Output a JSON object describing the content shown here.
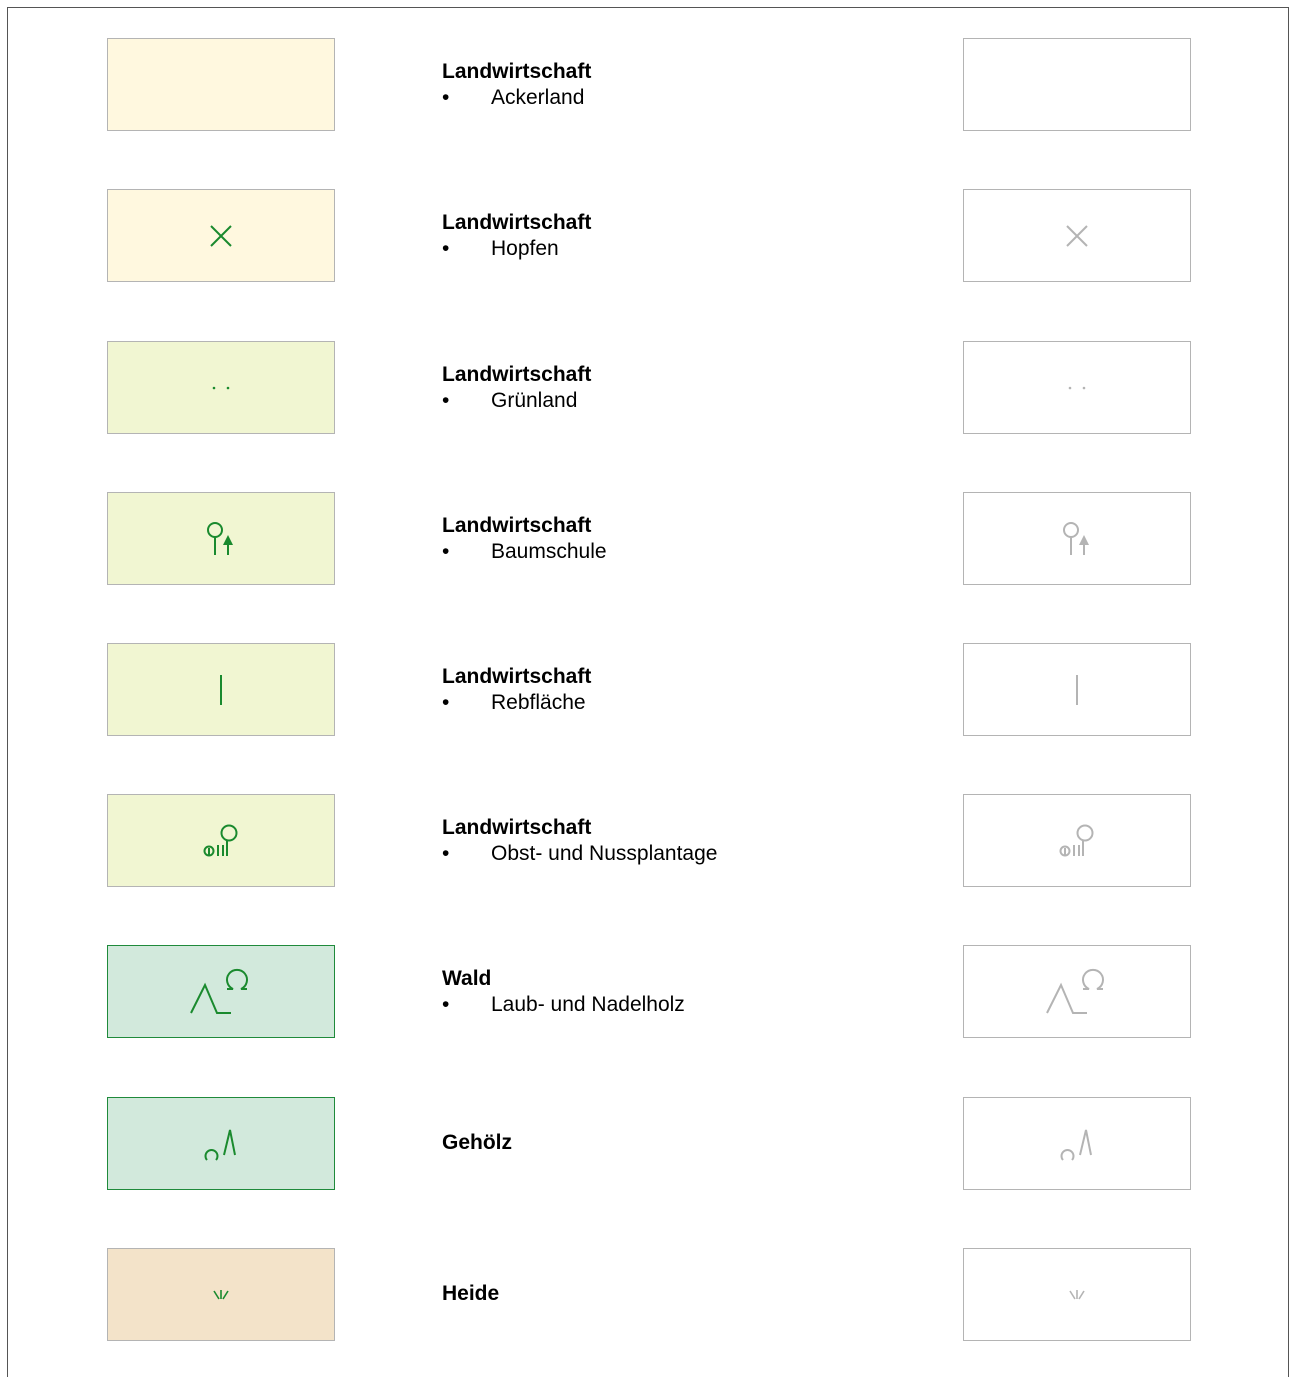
{
  "colors": {
    "symbol_green": "#1a8a2e",
    "symbol_gray": "#b4b4b4",
    "fill_ackerland": "#fff8df",
    "fill_hopfen": "#fff8df",
    "fill_gruenland": "#f1f6d2",
    "fill_baumschule": "#f1f6d2",
    "fill_rebflaeche": "#f1f6d2",
    "fill_obst": "#f1f6d2",
    "fill_wald": "#d2e9dc",
    "fill_gehoelz": "#d2e9dc",
    "fill_heide": "#f3e3c9"
  },
  "legend": [
    {
      "title": "Landwirtschaft",
      "item": "Ackerland",
      "symbol": "none"
    },
    {
      "title": "Landwirtschaft",
      "item": "Hopfen",
      "symbol": "cross-icon"
    },
    {
      "title": "Landwirtschaft",
      "item": "Grünland",
      "symbol": "dots-icon"
    },
    {
      "title": "Landwirtschaft",
      "item": "Baumschule",
      "symbol": "nursery-tree-icon"
    },
    {
      "title": "Landwirtschaft",
      "item": "Rebfläche",
      "symbol": "vine-line-icon"
    },
    {
      "title": "Landwirtschaft",
      "item": "Obst- und Nussplantage",
      "symbol": "orchard-icon"
    },
    {
      "title": "Wald",
      "item": "Laub- und Nadelholz",
      "symbol": "mixed-forest-icon"
    },
    {
      "title": "Gehölz",
      "item": "",
      "symbol": "shrub-icon"
    },
    {
      "title": "Heide",
      "item": "",
      "symbol": "heath-icon"
    }
  ]
}
